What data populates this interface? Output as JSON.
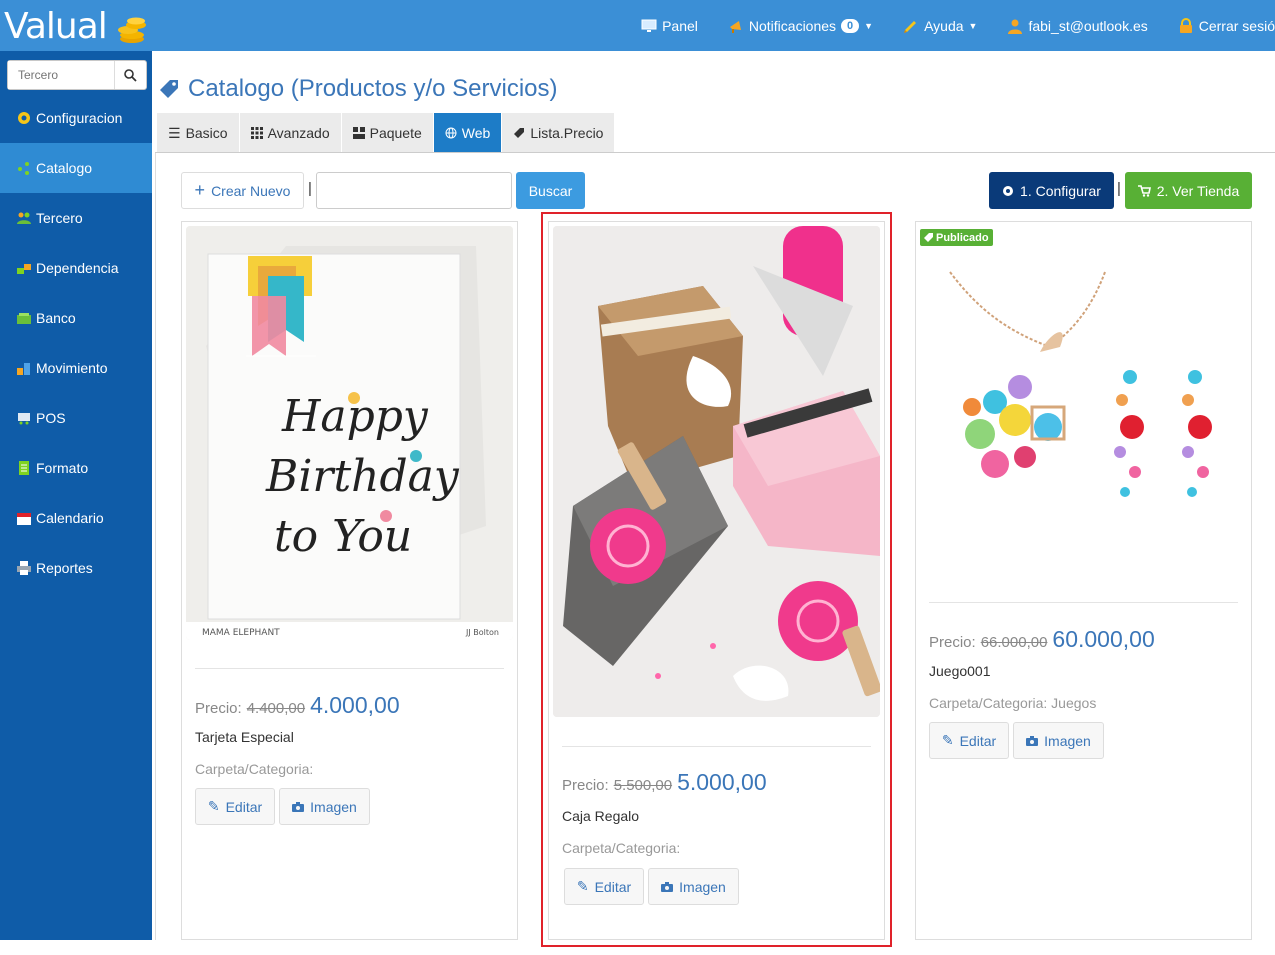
{
  "app": {
    "logo_text": "Valual"
  },
  "topnav": {
    "panel": "Panel",
    "notifications": "Notificaciones",
    "notifications_count": "0",
    "help": "Ayuda",
    "user": "fabi_st@outlook.es",
    "logout": "Cerrar sesió"
  },
  "sidebar": {
    "search_placeholder": "Tercero",
    "items": [
      {
        "label": "Configuracion"
      },
      {
        "label": "Catalogo"
      },
      {
        "label": "Tercero"
      },
      {
        "label": "Dependencia"
      },
      {
        "label": "Banco"
      },
      {
        "label": "Movimiento"
      },
      {
        "label": "POS"
      },
      {
        "label": "Formato"
      },
      {
        "label": "Calendario"
      },
      {
        "label": "Reportes"
      }
    ]
  },
  "page": {
    "title": "Catalogo (Productos y/o Servicios)"
  },
  "tabs": [
    {
      "label": "Basico"
    },
    {
      "label": "Avanzado"
    },
    {
      "label": "Paquete"
    },
    {
      "label": "Web"
    },
    {
      "label": "Lista.Precio"
    }
  ],
  "toolbar": {
    "new_label": "Crear Nuevo",
    "separator": "|",
    "search_value": "",
    "search_button": "Buscar",
    "configure_label": "1. Configurar",
    "store_label": "2. Ver Tienda"
  },
  "cards": [
    {
      "price_label": "Precio:",
      "old_price": "4.400,00",
      "price": "4.000,00",
      "name": "Tarjeta Especial",
      "category": "Carpeta/Categoria:",
      "edit": "Editar",
      "image": "Imagen",
      "img_caption_left": "MAMA ELEPHANT",
      "img_caption_right": "JJ Bolton",
      "card_line1": "Happy",
      "card_line2": "Birthday",
      "card_line3": "to You"
    },
    {
      "price_label": "Precio:",
      "old_price": "5.500,00",
      "price": "5.000,00",
      "name": "Caja Regalo",
      "category": "Carpeta/Categoria:",
      "edit": "Editar",
      "image": "Imagen"
    },
    {
      "badge": "Publicado",
      "price_label": "Precio:",
      "old_price": "66.000,00",
      "price": "60.000,00",
      "name": "Juego001",
      "category": "Carpeta/Categoria: Juegos",
      "edit": "Editar",
      "image": "Imagen"
    }
  ],
  "colors": {
    "topbar": "#3b8fd6",
    "sidebar": "#0f5ca8",
    "sidebar_active": "#2f8bd3",
    "tab_active": "#1d7cc7",
    "highlight": "#e0222a",
    "green": "#58b035",
    "navy": "#0a3a79"
  }
}
